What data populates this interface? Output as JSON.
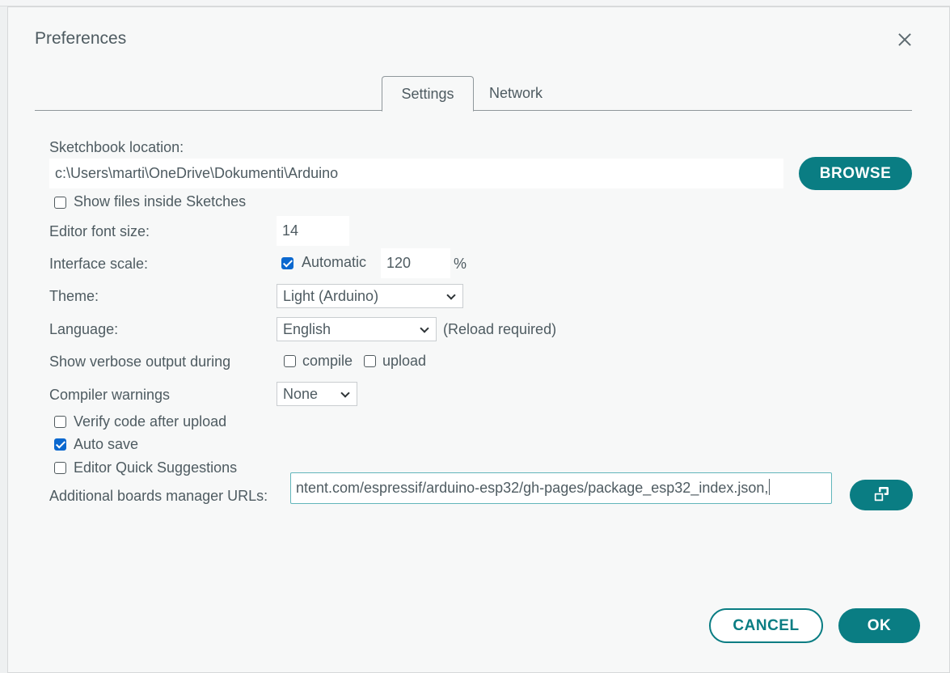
{
  "dialog": {
    "title": "Preferences",
    "close_icon": "close-icon"
  },
  "tabs": [
    {
      "label": "Settings",
      "active": true
    },
    {
      "label": "Network",
      "active": false
    }
  ],
  "settings": {
    "sketchbook_label": "Sketchbook location:",
    "sketchbook_value": "c:\\Users\\marti\\OneDrive\\Dokumenti\\Arduino",
    "browse_label": "BROWSE",
    "show_files_label": "Show files inside Sketches",
    "show_files_checked": false,
    "font_size_label": "Editor font size:",
    "font_size_value": "14",
    "scale_label": "Interface scale:",
    "scale_auto_label": "Automatic",
    "scale_auto_checked": true,
    "scale_value": "120",
    "scale_unit": "%",
    "theme_label": "Theme:",
    "theme_value": "Light (Arduino)",
    "language_label": "Language:",
    "language_value": "English",
    "language_note": "(Reload required)",
    "verbose_label": "Show verbose output during",
    "compile_label": "compile",
    "compile_checked": false,
    "upload_label": "upload",
    "upload_checked": false,
    "warnings_label": "Compiler warnings",
    "warnings_value": "None",
    "verify_label": "Verify code after upload",
    "verify_checked": false,
    "autosave_label": "Auto save",
    "autosave_checked": true,
    "quick_suggestions_label": "Editor Quick Suggestions",
    "quick_suggestions_checked": false,
    "boards_label": "Additional boards manager URLs:",
    "boards_value": "ntent.com/espressif/arduino-esp32/gh-pages/package_esp32_index.json,",
    "boards_edit_icon": "open-window-icon"
  },
  "footer": {
    "cancel_label": "CANCEL",
    "ok_label": "OK"
  },
  "colors": {
    "accent": "#0a7d83",
    "checkbox_checked": "#0b68cf",
    "text": "#4e5b61"
  }
}
